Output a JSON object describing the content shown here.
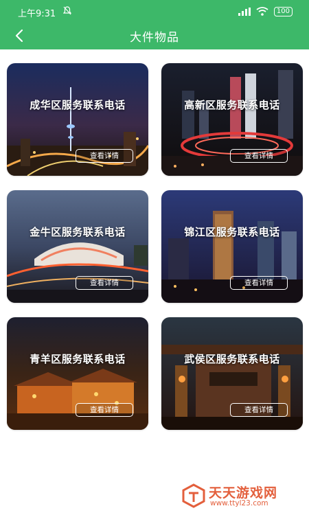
{
  "status_bar": {
    "time": "上午9:31",
    "battery": "100"
  },
  "header": {
    "title": "大件物品"
  },
  "cards": [
    {
      "title": "成华区服务联系电话",
      "button_label": "查看详情"
    },
    {
      "title": "高新区服务联系电话",
      "button_label": "查看详情"
    },
    {
      "title": "金牛区服务联系电话",
      "button_label": "查看详情"
    },
    {
      "title": "锦江区服务联系电话",
      "button_label": "查看详情"
    },
    {
      "title": "青羊区服务联系电话",
      "button_label": "查看详情"
    },
    {
      "title": "武侯区服务联系电话",
      "button_label": "查看详情"
    }
  ],
  "watermark": {
    "name": "天天游戏网",
    "url": "www.ttyl23.com"
  },
  "colors": {
    "brand_green": "#3db869",
    "watermark": "#e35f3c"
  }
}
